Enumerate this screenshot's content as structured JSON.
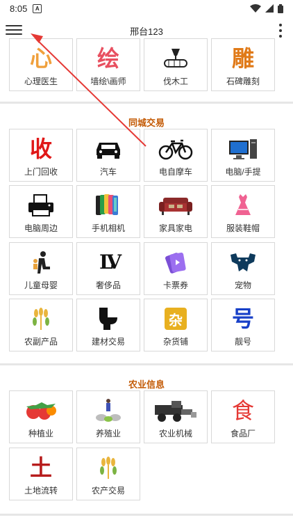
{
  "status": {
    "time": "8:05",
    "notif": "A"
  },
  "appbar": {
    "title": "邢台123"
  },
  "top_row": [
    {
      "label": "心理医生",
      "icon": "psychology-icon",
      "glyph": "心"
    },
    {
      "label": "墙绘\\画师",
      "icon": "mural-icon",
      "glyph": "绘"
    },
    {
      "label": "伐木工",
      "icon": "logging-icon"
    },
    {
      "label": "石碑雕刻",
      "icon": "stone-carving-icon",
      "glyph": "雕"
    }
  ],
  "sections": [
    {
      "title": "同城交易",
      "items": [
        {
          "label": "上门回收",
          "icon": "recycle-icon",
          "glyph": "收"
        },
        {
          "label": "汽车",
          "icon": "car-icon"
        },
        {
          "label": "电自摩车",
          "icon": "bicycle-icon"
        },
        {
          "label": "电脑/手提",
          "icon": "computer-icon"
        },
        {
          "label": "电脑周边",
          "icon": "printer-icon"
        },
        {
          "label": "手机相机",
          "icon": "phones-icon"
        },
        {
          "label": "家具家电",
          "icon": "sofa-icon"
        },
        {
          "label": "服装鞋帽",
          "icon": "dress-icon"
        },
        {
          "label": "儿童母婴",
          "icon": "mother-baby-icon"
        },
        {
          "label": "奢侈品",
          "icon": "luxury-icon",
          "glyph": "LV"
        },
        {
          "label": "卡票券",
          "icon": "ticket-icon"
        },
        {
          "label": "宠物",
          "icon": "pet-icon"
        },
        {
          "label": "农副产品",
          "icon": "wheat-icon"
        },
        {
          "label": "建材交易",
          "icon": "toilet-icon"
        },
        {
          "label": "杂货铺",
          "icon": "grocery-icon",
          "glyph": "杂"
        },
        {
          "label": "靓号",
          "icon": "number-icon",
          "glyph": "号"
        }
      ]
    },
    {
      "title": "农业信息",
      "items": [
        {
          "label": "种植业",
          "icon": "vegetables-icon"
        },
        {
          "label": "养殖业",
          "icon": "farming-icon"
        },
        {
          "label": "农业机械",
          "icon": "harvester-icon"
        },
        {
          "label": "食品厂",
          "icon": "food-factory-icon",
          "glyph": "食"
        },
        {
          "label": "土地流转",
          "icon": "land-icon",
          "glyph": "土"
        },
        {
          "label": "农产交易",
          "icon": "wheat-icon"
        }
      ]
    }
  ],
  "colors": {
    "section_title": "#c35a05",
    "border": "#d8d8d8",
    "accent_red": "#e53935"
  }
}
